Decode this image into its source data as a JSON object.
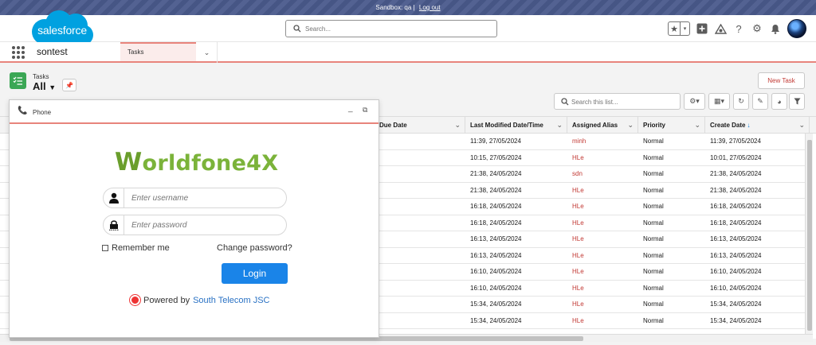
{
  "sandbox": {
    "text": "Sandbox: qa |",
    "logout": "Log out"
  },
  "header": {
    "logo_text": "salesforce",
    "search_placeholder": "Search...",
    "icons": [
      "favorites-star-icon",
      "favorites-dropdown-icon",
      "global-actions-icon",
      "trailhead-icon",
      "help-icon",
      "setup-gear-icon",
      "notifications-bell-icon",
      "user-avatar"
    ]
  },
  "nav": {
    "app_name": "sontest",
    "tab_label": "Tasks"
  },
  "list": {
    "object_label": "Tasks",
    "view_name": "All",
    "new_button": "New Task",
    "search_placeholder": "Search this list..."
  },
  "table": {
    "columns": {
      "due_date": "Due Date",
      "last_modified": "Last Modified Date/Time",
      "assigned_alias": "Assigned Alias",
      "priority": "Priority",
      "create_date": "Create Date"
    },
    "rows": [
      {
        "last_modified": "11:39, 27/05/2024",
        "alias": "minh",
        "priority": "Normal",
        "create_date": "11:39, 27/05/2024"
      },
      {
        "last_modified": "10:15, 27/05/2024",
        "alias": "HLe",
        "priority": "Normal",
        "create_date": "10:01, 27/05/2024"
      },
      {
        "last_modified": "21:38, 24/05/2024",
        "alias": "sdn",
        "priority": "Normal",
        "create_date": "21:38, 24/05/2024"
      },
      {
        "last_modified": "21:38, 24/05/2024",
        "alias": "HLe",
        "priority": "Normal",
        "create_date": "21:38, 24/05/2024"
      },
      {
        "last_modified": "16:18, 24/05/2024",
        "alias": "HLe",
        "priority": "Normal",
        "create_date": "16:18, 24/05/2024"
      },
      {
        "last_modified": "16:18, 24/05/2024",
        "alias": "HLe",
        "priority": "Normal",
        "create_date": "16:18, 24/05/2024"
      },
      {
        "last_modified": "16:13, 24/05/2024",
        "alias": "HLe",
        "priority": "Normal",
        "create_date": "16:13, 24/05/2024"
      },
      {
        "last_modified": "16:13, 24/05/2024",
        "alias": "HLe",
        "priority": "Normal",
        "create_date": "16:13, 24/05/2024"
      },
      {
        "last_modified": "16:10, 24/05/2024",
        "alias": "HLe",
        "priority": "Normal",
        "create_date": "16:10, 24/05/2024"
      },
      {
        "last_modified": "16:10, 24/05/2024",
        "alias": "HLe",
        "priority": "Normal",
        "create_date": "16:10, 24/05/2024"
      },
      {
        "last_modified": "15:34, 24/05/2024",
        "alias": "HLe",
        "priority": "Normal",
        "create_date": "15:34, 24/05/2024"
      },
      {
        "last_modified": "15:34, 24/05/2024",
        "alias": "HLe",
        "priority": "Normal",
        "create_date": "15:34, 24/05/2024"
      }
    ]
  },
  "phone": {
    "title": "Phone",
    "logo_first": "W",
    "logo_rest": "orldfone4X",
    "username_placeholder": "Enter username",
    "password_placeholder": "Enter password",
    "remember_label": "Remember me",
    "change_password": "Change password?",
    "login_button": "Login",
    "powered_prefix": "Powered by",
    "powered_company": "South Telecom JSC"
  },
  "colors": {
    "brand_blue": "#00a1e0",
    "accent_coral": "#e8847c",
    "alias_red": "#c23934",
    "login_blue": "#1a84e8",
    "wf_green": "#7bb33a"
  }
}
